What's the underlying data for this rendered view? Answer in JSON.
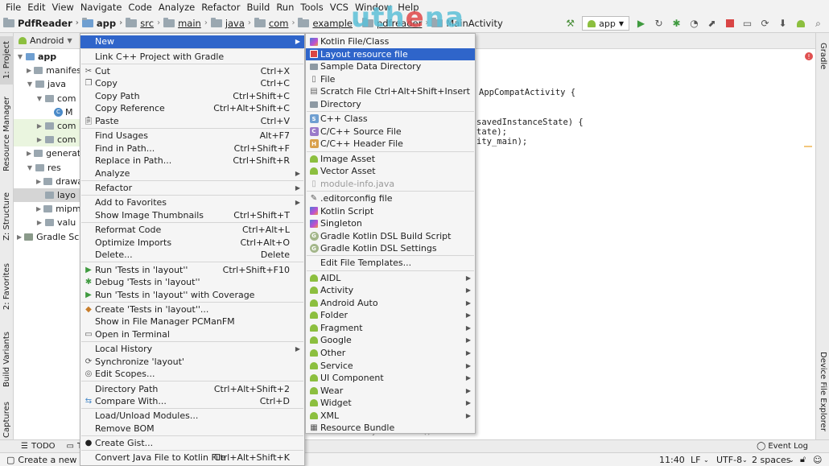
{
  "menubar": [
    "File",
    "Edit",
    "View",
    "Navigate",
    "Code",
    "Analyze",
    "Refactor",
    "Build",
    "Run",
    "Tools",
    "VCS",
    "Window",
    "Help"
  ],
  "breadcrumbs": [
    "PdfReader",
    "app",
    "src",
    "main",
    "java",
    "com",
    "example",
    "pdfreader",
    "MainActivity"
  ],
  "run_config": "app",
  "watermark": {
    "prefix": "uth",
    "o": "e",
    "suffix": "na"
  },
  "left_tabs": [
    "1: Project",
    "Resource Manager",
    "Z: Structure",
    "2: Favorites",
    "Build Variants",
    "Captures"
  ],
  "right_tabs": [
    "Gradle",
    "Device File Explorer"
  ],
  "project": {
    "view": "Android",
    "tree": [
      "app",
      "manifests",
      "java",
      "com",
      "M",
      "com",
      "com",
      "generat",
      "res",
      "drawa",
      "layo",
      "mipm",
      "valu",
      "Gradle Scripts"
    ]
  },
  "code": {
    "line1": "AppCompatActivity {",
    "line2": "savedInstanceState) {",
    "line3": "tate);",
    "line4": "ity_main);",
    "line5": "MainActivity  onCreate()"
  },
  "bottom_tabs": [
    "TODO",
    "T"
  ],
  "event_log": "Event Log",
  "status": {
    "message": "Create a new L",
    "position": "11:40",
    "line_sep": "LF",
    "encoding": "UTF-8",
    "indent": "2 spaces"
  },
  "context_menu": [
    {
      "label": "New",
      "shortcut": "",
      "arrow": true,
      "active": true
    },
    {
      "sep": true
    },
    {
      "label": "Link C++ Project with Gradle",
      "shortcut": ""
    },
    {
      "sep": true
    },
    {
      "label": "Cut",
      "shortcut": "Ctrl+X",
      "icon": "cut-icon"
    },
    {
      "label": "Copy",
      "shortcut": "Ctrl+C",
      "icon": "copy-icon"
    },
    {
      "label": "Copy Path",
      "shortcut": "Ctrl+Shift+C"
    },
    {
      "label": "Copy Reference",
      "shortcut": "Ctrl+Alt+Shift+C"
    },
    {
      "label": "Paste",
      "shortcut": "Ctrl+V",
      "icon": "paste-icon"
    },
    {
      "sep": true
    },
    {
      "label": "Find Usages",
      "shortcut": "Alt+F7"
    },
    {
      "label": "Find in Path...",
      "shortcut": "Ctrl+Shift+F"
    },
    {
      "label": "Replace in Path...",
      "shortcut": "Ctrl+Shift+R"
    },
    {
      "label": "Analyze",
      "shortcut": "",
      "arrow": true
    },
    {
      "sep": true
    },
    {
      "label": "Refactor",
      "shortcut": "",
      "arrow": true
    },
    {
      "sep": true
    },
    {
      "label": "Add to Favorites",
      "shortcut": "",
      "arrow": true
    },
    {
      "label": "Show Image Thumbnails",
      "shortcut": "Ctrl+Shift+T"
    },
    {
      "sep": true
    },
    {
      "label": "Reformat Code",
      "shortcut": "Ctrl+Alt+L"
    },
    {
      "label": "Optimize Imports",
      "shortcut": "Ctrl+Alt+O"
    },
    {
      "label": "Delete...",
      "shortcut": "Delete"
    },
    {
      "sep": true
    },
    {
      "label": "Run 'Tests in 'layout''",
      "shortcut": "Ctrl+Shift+F10",
      "icon": "run-icon"
    },
    {
      "label": "Debug 'Tests in 'layout''",
      "shortcut": "",
      "icon": "debug-icon"
    },
    {
      "label": "Run 'Tests in 'layout'' with Coverage",
      "shortcut": "",
      "icon": "coverage-icon"
    },
    {
      "sep": true
    },
    {
      "label": "Create 'Tests in 'layout''...",
      "shortcut": "",
      "icon": "create-test-icon"
    },
    {
      "label": "Show in File Manager PCManFM",
      "shortcut": ""
    },
    {
      "label": "Open in Terminal",
      "shortcut": "",
      "icon": "terminal-icon"
    },
    {
      "sep": true
    },
    {
      "label": "Local History",
      "shortcut": "",
      "arrow": true
    },
    {
      "label": "Synchronize 'layout'",
      "shortcut": "",
      "icon": "sync-icon"
    },
    {
      "label": "Edit Scopes...",
      "shortcut": "",
      "icon": "scopes-icon"
    },
    {
      "sep": true
    },
    {
      "label": "Directory Path",
      "shortcut": "Ctrl+Alt+Shift+2"
    },
    {
      "label": "Compare With...",
      "shortcut": "Ctrl+D",
      "icon": "compare-icon"
    },
    {
      "sep": true
    },
    {
      "label": "Load/Unload Modules...",
      "shortcut": ""
    },
    {
      "label": "Remove BOM",
      "shortcut": ""
    },
    {
      "sep": true
    },
    {
      "label": "Create Gist...",
      "shortcut": "",
      "icon": "github-icon"
    },
    {
      "sep": true
    },
    {
      "label": "Convert Java File to Kotlin File",
      "shortcut": "Ctrl+Alt+Shift+K"
    }
  ],
  "submenu": [
    {
      "label": "Kotlin File/Class",
      "icon": "kotlin-icon"
    },
    {
      "label": "Layout resource file",
      "icon": "layout-icon",
      "active": true
    },
    {
      "label": "Sample Data Directory",
      "icon": "folder-icon"
    },
    {
      "label": "File",
      "icon": "file-icon"
    },
    {
      "label": "Scratch File",
      "shortcut": "Ctrl+Alt+Shift+Insert",
      "icon": "scratch-icon"
    },
    {
      "label": "Directory",
      "icon": "folder-icon"
    },
    {
      "sep": true
    },
    {
      "label": "C++ Class",
      "icon": "cpp-class-icon"
    },
    {
      "label": "C/C++ Source File",
      "icon": "cpp-source-icon"
    },
    {
      "label": "C/C++ Header File",
      "icon": "cpp-header-icon"
    },
    {
      "sep": true
    },
    {
      "label": "Image Asset",
      "icon": "android-icon"
    },
    {
      "label": "Vector Asset",
      "icon": "android-icon"
    },
    {
      "label": "module-info.java",
      "icon": "java-icon",
      "disabled": true
    },
    {
      "sep": true
    },
    {
      "label": ".editorconfig file",
      "icon": "editorconfig-icon"
    },
    {
      "label": "Kotlin Script",
      "icon": "kotlin-icon"
    },
    {
      "label": "Singleton",
      "icon": "kotlin-icon"
    },
    {
      "label": "Gradle Kotlin DSL Build Script",
      "icon": "gradle-icon"
    },
    {
      "label": "Gradle Kotlin DSL Settings",
      "icon": "gradle-icon"
    },
    {
      "sep": true
    },
    {
      "label": "Edit File Templates...",
      "icon": ""
    },
    {
      "sep": true
    },
    {
      "label": "AIDL",
      "icon": "android-icon",
      "arrow": true
    },
    {
      "label": "Activity",
      "icon": "android-icon",
      "arrow": true
    },
    {
      "label": "Android Auto",
      "icon": "android-icon",
      "arrow": true
    },
    {
      "label": "Folder",
      "icon": "android-icon",
      "arrow": true
    },
    {
      "label": "Fragment",
      "icon": "android-icon",
      "arrow": true
    },
    {
      "label": "Google",
      "icon": "android-icon",
      "arrow": true
    },
    {
      "label": "Other",
      "icon": "android-icon",
      "arrow": true
    },
    {
      "label": "Service",
      "icon": "android-icon",
      "arrow": true
    },
    {
      "label": "UI Component",
      "icon": "android-icon",
      "arrow": true
    },
    {
      "label": "Wear",
      "icon": "android-icon",
      "arrow": true
    },
    {
      "label": "Widget",
      "icon": "android-icon",
      "arrow": true
    },
    {
      "label": "XML",
      "icon": "android-icon",
      "arrow": true
    },
    {
      "label": "Resource Bundle",
      "icon": "bundle-icon"
    }
  ],
  "colors": {
    "accent": "#2f65ca",
    "android_green": "#8cbf3f",
    "folder_gray": "#9aa7b0"
  }
}
